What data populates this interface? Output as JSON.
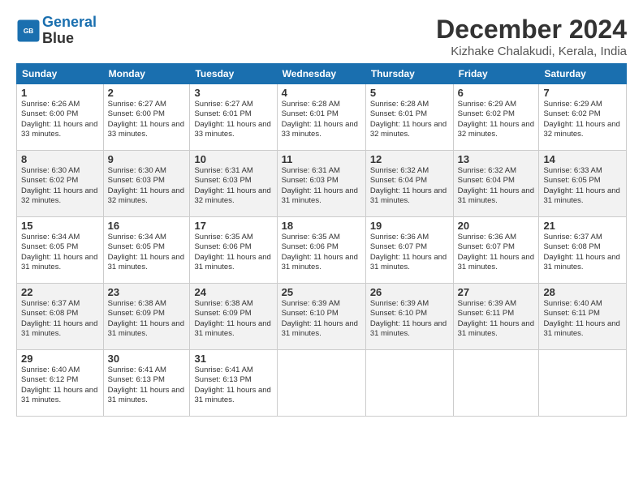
{
  "header": {
    "logo_line1": "General",
    "logo_line2": "Blue",
    "month_title": "December 2024",
    "location": "Kizhake Chalakudi, Kerala, India"
  },
  "days_of_week": [
    "Sunday",
    "Monday",
    "Tuesday",
    "Wednesday",
    "Thursday",
    "Friday",
    "Saturday"
  ],
  "weeks": [
    [
      {
        "day": "1",
        "sunrise": "6:26 AM",
        "sunset": "6:00 PM",
        "daylight": "11 hours and 33 minutes."
      },
      {
        "day": "2",
        "sunrise": "6:27 AM",
        "sunset": "6:00 PM",
        "daylight": "11 hours and 33 minutes."
      },
      {
        "day": "3",
        "sunrise": "6:27 AM",
        "sunset": "6:01 PM",
        "daylight": "11 hours and 33 minutes."
      },
      {
        "day": "4",
        "sunrise": "6:28 AM",
        "sunset": "6:01 PM",
        "daylight": "11 hours and 33 minutes."
      },
      {
        "day": "5",
        "sunrise": "6:28 AM",
        "sunset": "6:01 PM",
        "daylight": "11 hours and 32 minutes."
      },
      {
        "day": "6",
        "sunrise": "6:29 AM",
        "sunset": "6:02 PM",
        "daylight": "11 hours and 32 minutes."
      },
      {
        "day": "7",
        "sunrise": "6:29 AM",
        "sunset": "6:02 PM",
        "daylight": "11 hours and 32 minutes."
      }
    ],
    [
      {
        "day": "8",
        "sunrise": "6:30 AM",
        "sunset": "6:02 PM",
        "daylight": "11 hours and 32 minutes."
      },
      {
        "day": "9",
        "sunrise": "6:30 AM",
        "sunset": "6:03 PM",
        "daylight": "11 hours and 32 minutes."
      },
      {
        "day": "10",
        "sunrise": "6:31 AM",
        "sunset": "6:03 PM",
        "daylight": "11 hours and 32 minutes."
      },
      {
        "day": "11",
        "sunrise": "6:31 AM",
        "sunset": "6:03 PM",
        "daylight": "11 hours and 31 minutes."
      },
      {
        "day": "12",
        "sunrise": "6:32 AM",
        "sunset": "6:04 PM",
        "daylight": "11 hours and 31 minutes."
      },
      {
        "day": "13",
        "sunrise": "6:32 AM",
        "sunset": "6:04 PM",
        "daylight": "11 hours and 31 minutes."
      },
      {
        "day": "14",
        "sunrise": "6:33 AM",
        "sunset": "6:05 PM",
        "daylight": "11 hours and 31 minutes."
      }
    ],
    [
      {
        "day": "15",
        "sunrise": "6:34 AM",
        "sunset": "6:05 PM",
        "daylight": "11 hours and 31 minutes."
      },
      {
        "day": "16",
        "sunrise": "6:34 AM",
        "sunset": "6:05 PM",
        "daylight": "11 hours and 31 minutes."
      },
      {
        "day": "17",
        "sunrise": "6:35 AM",
        "sunset": "6:06 PM",
        "daylight": "11 hours and 31 minutes."
      },
      {
        "day": "18",
        "sunrise": "6:35 AM",
        "sunset": "6:06 PM",
        "daylight": "11 hours and 31 minutes."
      },
      {
        "day": "19",
        "sunrise": "6:36 AM",
        "sunset": "6:07 PM",
        "daylight": "11 hours and 31 minutes."
      },
      {
        "day": "20",
        "sunrise": "6:36 AM",
        "sunset": "6:07 PM",
        "daylight": "11 hours and 31 minutes."
      },
      {
        "day": "21",
        "sunrise": "6:37 AM",
        "sunset": "6:08 PM",
        "daylight": "11 hours and 31 minutes."
      }
    ],
    [
      {
        "day": "22",
        "sunrise": "6:37 AM",
        "sunset": "6:08 PM",
        "daylight": "11 hours and 31 minutes."
      },
      {
        "day": "23",
        "sunrise": "6:38 AM",
        "sunset": "6:09 PM",
        "daylight": "11 hours and 31 minutes."
      },
      {
        "day": "24",
        "sunrise": "6:38 AM",
        "sunset": "6:09 PM",
        "daylight": "11 hours and 31 minutes."
      },
      {
        "day": "25",
        "sunrise": "6:39 AM",
        "sunset": "6:10 PM",
        "daylight": "11 hours and 31 minutes."
      },
      {
        "day": "26",
        "sunrise": "6:39 AM",
        "sunset": "6:10 PM",
        "daylight": "11 hours and 31 minutes."
      },
      {
        "day": "27",
        "sunrise": "6:39 AM",
        "sunset": "6:11 PM",
        "daylight": "11 hours and 31 minutes."
      },
      {
        "day": "28",
        "sunrise": "6:40 AM",
        "sunset": "6:11 PM",
        "daylight": "11 hours and 31 minutes."
      }
    ],
    [
      {
        "day": "29",
        "sunrise": "6:40 AM",
        "sunset": "6:12 PM",
        "daylight": "11 hours and 31 minutes."
      },
      {
        "day": "30",
        "sunrise": "6:41 AM",
        "sunset": "6:13 PM",
        "daylight": "11 hours and 31 minutes."
      },
      {
        "day": "31",
        "sunrise": "6:41 AM",
        "sunset": "6:13 PM",
        "daylight": "11 hours and 31 minutes."
      },
      null,
      null,
      null,
      null
    ]
  ]
}
